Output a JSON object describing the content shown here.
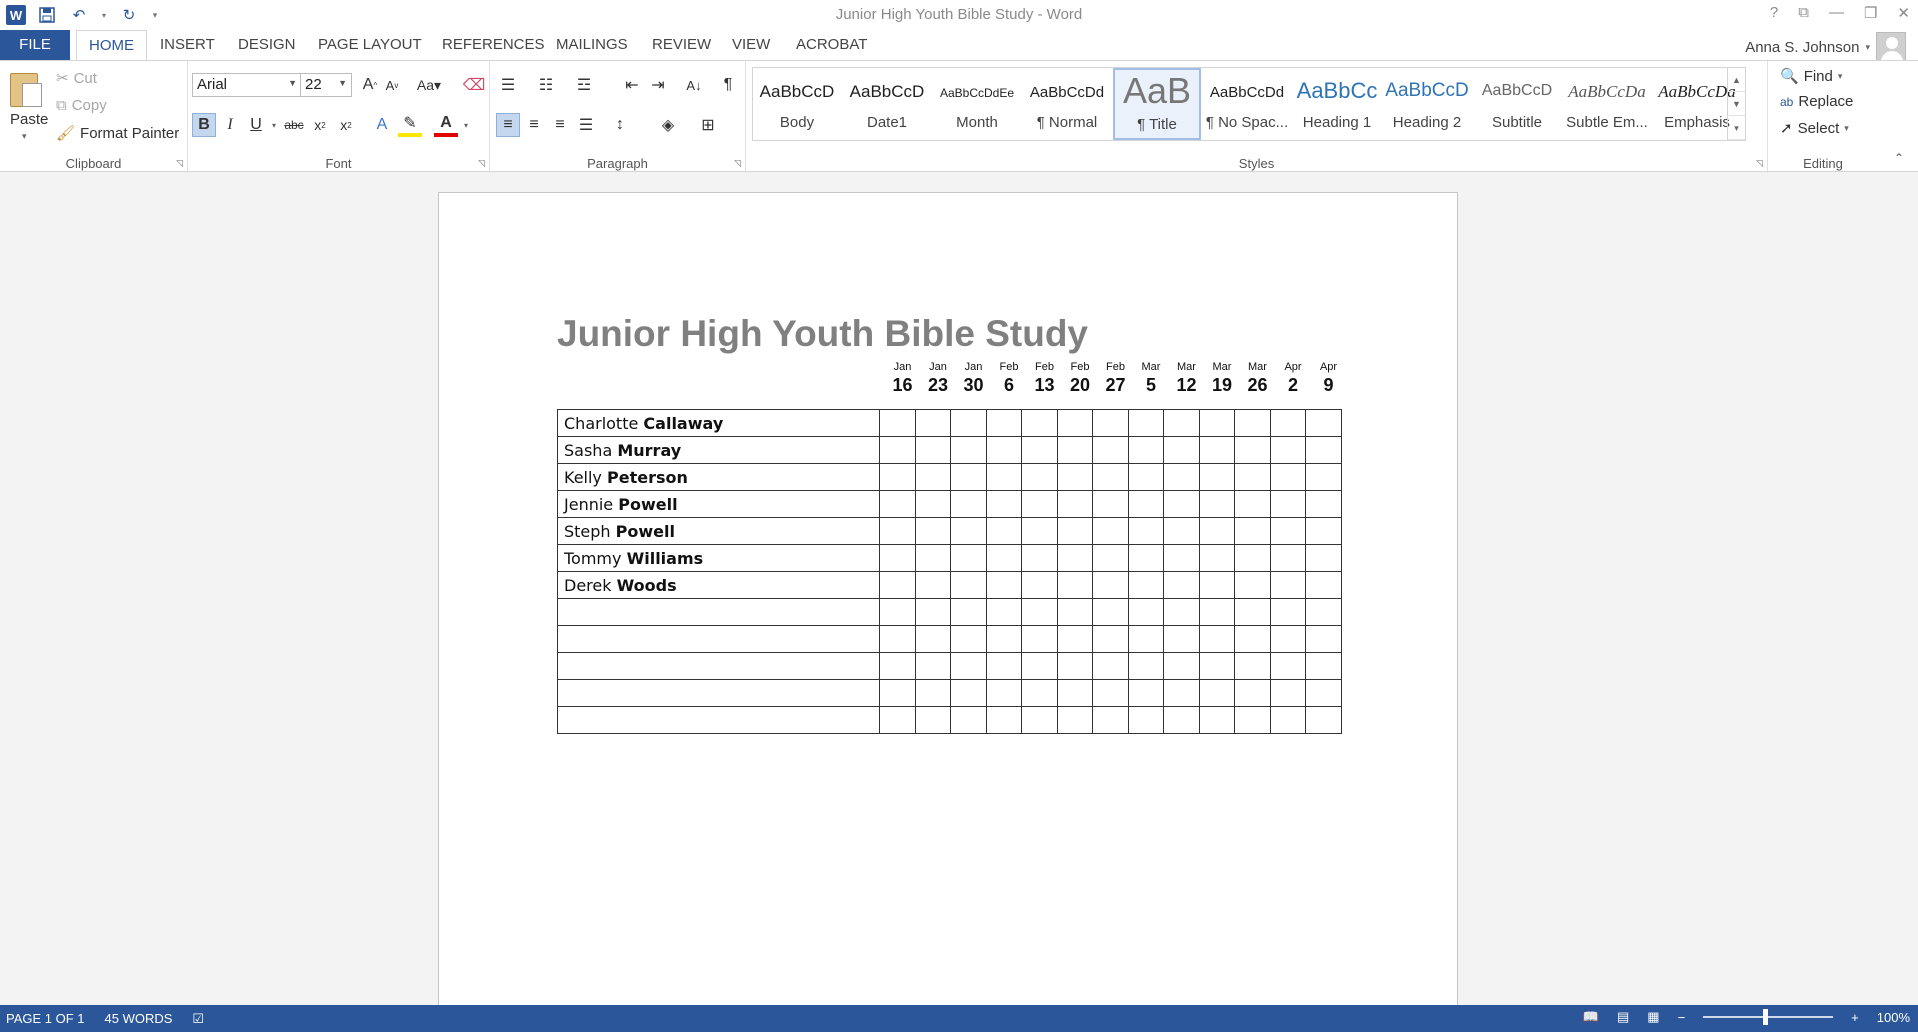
{
  "window": {
    "title": "Junior High Youth Bible Study - Word"
  },
  "tabs": [
    {
      "label": "FILE"
    },
    {
      "label": "HOME"
    },
    {
      "label": "INSERT"
    },
    {
      "label": "DESIGN"
    },
    {
      "label": "PAGE LAYOUT"
    },
    {
      "label": "REFERENCES"
    },
    {
      "label": "MAILINGS"
    },
    {
      "label": "REVIEW"
    },
    {
      "label": "VIEW"
    },
    {
      "label": "ACROBAT"
    }
  ],
  "user": {
    "name": "Anna S. Johnson"
  },
  "clipboard": {
    "group_label": "Clipboard",
    "paste": "Paste",
    "cut": "Cut",
    "copy": "Copy",
    "format_painter": "Format Painter"
  },
  "font": {
    "group_label": "Font",
    "font_name": "Arial",
    "font_size": "22"
  },
  "paragraph": {
    "group_label": "Paragraph"
  },
  "styles": {
    "group_label": "Styles",
    "items": [
      {
        "sample": "AaBbCcD",
        "name": "Body"
      },
      {
        "sample": "AaBbCcD",
        "name": "Date1"
      },
      {
        "sample": "AaBbCcDdEe",
        "name": "Month"
      },
      {
        "sample": "AaBbCcDd",
        "name": "¶ Normal"
      },
      {
        "sample": "AaB",
        "name": "¶ Title"
      },
      {
        "sample": "AaBbCcDd",
        "name": "¶ No Spac..."
      },
      {
        "sample": "AaBbCc",
        "name": "Heading 1"
      },
      {
        "sample": "AaBbCcD",
        "name": "Heading 2"
      },
      {
        "sample": "AaBbCcD",
        "name": "Subtitle"
      },
      {
        "sample": "AaBbCcDa",
        "name": "Subtle Em..."
      },
      {
        "sample": "AaBbCcDa",
        "name": "Emphasis"
      }
    ]
  },
  "editing": {
    "group_label": "Editing",
    "find": "Find",
    "replace": "Replace",
    "select": "Select"
  },
  "document": {
    "title": "Junior High Youth Bible Study",
    "dates": [
      {
        "month": "Jan",
        "day": "16"
      },
      {
        "month": "Jan",
        "day": "23"
      },
      {
        "month": "Jan",
        "day": "30"
      },
      {
        "month": "Feb",
        "day": "6"
      },
      {
        "month": "Feb",
        "day": "13"
      },
      {
        "month": "Feb",
        "day": "20"
      },
      {
        "month": "Feb",
        "day": "27"
      },
      {
        "month": "Mar",
        "day": "5"
      },
      {
        "month": "Mar",
        "day": "12"
      },
      {
        "month": "Mar",
        "day": "19"
      },
      {
        "month": "Mar",
        "day": "26"
      },
      {
        "month": "Apr",
        "day": "2"
      },
      {
        "month": "Apr",
        "day": "9"
      }
    ],
    "students": [
      {
        "first": "Charlotte",
        "last": "Callaway"
      },
      {
        "first": "Sasha",
        "last": "Murray"
      },
      {
        "first": "Kelly",
        "last": "Peterson"
      },
      {
        "first": "Jennie",
        "last": "Powell"
      },
      {
        "first": "Steph",
        "last": "Powell"
      },
      {
        "first": "Tommy",
        "last": "Williams"
      },
      {
        "first": "Derek",
        "last": "Woods"
      },
      {
        "first": "",
        "last": ""
      },
      {
        "first": "",
        "last": ""
      },
      {
        "first": "",
        "last": ""
      },
      {
        "first": "",
        "last": ""
      },
      {
        "first": "",
        "last": ""
      }
    ]
  },
  "statusbar": {
    "page": "PAGE 1 OF 1",
    "words": "45 WORDS",
    "zoom": "100%"
  },
  "colors": {
    "accent": "#2b579a",
    "title_gray": "#808080"
  }
}
